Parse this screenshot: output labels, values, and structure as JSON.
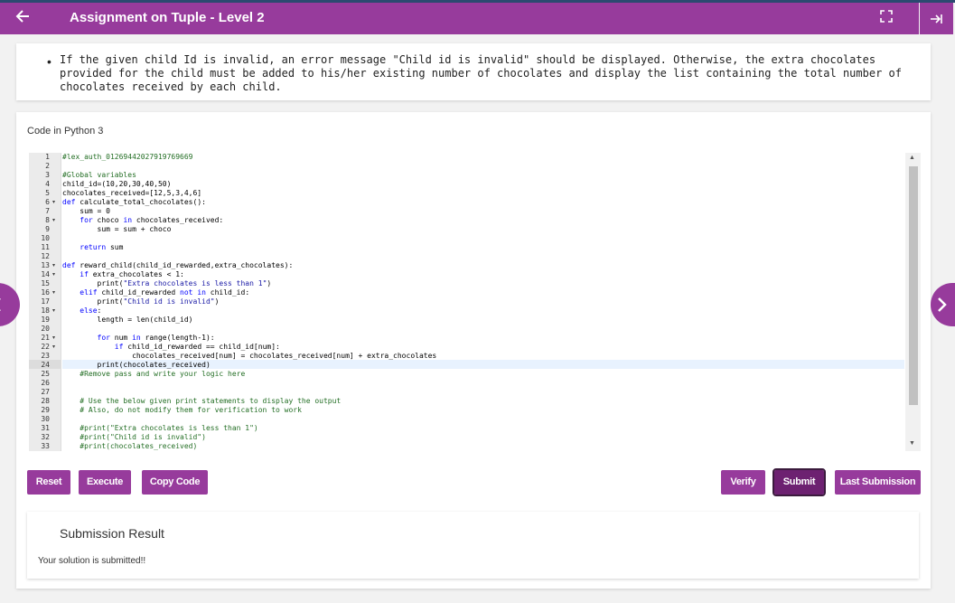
{
  "header": {
    "title": "Assignment on Tuple - Level 2",
    "back_icon": "arrow-left-icon",
    "fullscreen_icon": "fullscreen-icon",
    "collapse_icon": "collapse-panel-icon",
    "accent_color": "#973b9c"
  },
  "description": {
    "text": "If the given child Id is invalid, an error message \"Child id is invalid\" should be displayed. Otherwise, the extra chocolates provided for the child must be added to his/her existing number of chocolates and display the list containing the total number of chocolates received by each child."
  },
  "editor": {
    "language_label": "Code in Python 3",
    "lines": [
      "#lex_auth_01269442027919769669",
      "",
      "#Global variables",
      "child_id=(10,20,30,40,50)",
      "chocolates_received=[12,5,3,4,6]",
      "def calculate_total_chocolates():",
      "    sum = 0",
      "    for choco in chocolates_received:",
      "        sum = sum + choco",
      "",
      "    return sum",
      "",
      "def reward_child(child_id_rewarded,extra_chocolates):",
      "    if extra_chocolates < 1:",
      "        print(\"Extra chocolates is less than 1\")",
      "    elif child_id_rewarded not in child_id:",
      "        print(\"Child id is invalid\")",
      "    else:",
      "        length = len(child_id)",
      "",
      "        for num in range(length-1):",
      "            if child_id_rewarded == child_id[num]:",
      "                chocolates_received[num] = chocolates_received[num] + extra_chocolates",
      "        print(chocolates_received)",
      "    #Remove pass and write your logic here",
      "",
      "",
      "    # Use the below given print statements to display the output",
      "    # Also, do not modify them for verification to work",
      "",
      "    #print(\"Extra chocolates is less than 1\")",
      "    #print(\"Child id is invalid\")",
      "    #print(chocolates_received)"
    ],
    "fold_lines": [
      6,
      8,
      13,
      14,
      16,
      18,
      21,
      22
    ],
    "highlight_line": 24
  },
  "buttons": {
    "reset": "Reset",
    "execute": "Execute",
    "copy_code": "Copy Code",
    "verify": "Verify",
    "submit": "Submit",
    "last_submission": "Last Submission"
  },
  "result": {
    "title": "Submission Result",
    "message": "Your solution is submitted!!"
  },
  "nav": {
    "prev_icon": "chevron-left-icon",
    "next_icon": "chevron-right-icon"
  }
}
